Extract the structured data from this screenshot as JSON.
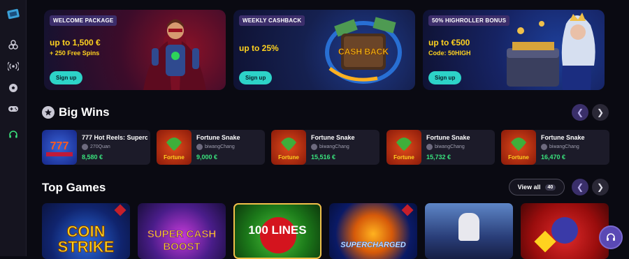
{
  "sidebar": {
    "items": [
      {
        "icon": "logo-icon"
      },
      {
        "icon": "dice-icon"
      },
      {
        "icon": "live-broadcast-icon"
      },
      {
        "icon": "soccer-ball-icon"
      },
      {
        "icon": "gamepad-icon"
      },
      {
        "icon": "headset-icon"
      }
    ]
  },
  "banners": [
    {
      "tag": "WELCOME PACKAGE",
      "line1": "up to 1,500 €",
      "line2": "+ 250 Free Spins",
      "button": "Sign up",
      "art": "superhero-illustration"
    },
    {
      "tag": "WEEKLY CASHBACK",
      "line1": "up to 25%",
      "line2": "",
      "button": "Sign up",
      "art": "cash-back-illustration",
      "art_text": "CASH BACK"
    },
    {
      "tag": "50% HIGHROLLER BONUS",
      "line1": "up to €500",
      "line2": "Code: 50HIGH",
      "button": "Sign up",
      "art": "treasure-queen-illustration"
    }
  ],
  "big_wins": {
    "title": "Big Wins",
    "items": [
      {
        "game": "777 Hot Reels: Superc",
        "user": "270Quan",
        "amount": "8,580 €"
      },
      {
        "game": "Fortune Snake",
        "user": "biwangChang",
        "amount": "9,000 €"
      },
      {
        "game": "Fortune Snake",
        "user": "biwangChang",
        "amount": "15,516 €"
      },
      {
        "game": "Fortune Snake",
        "user": "biwangChang",
        "amount": "15,732 €"
      },
      {
        "game": "Fortune Snake",
        "user": "biwangChang",
        "amount": "16,470 €"
      }
    ]
  },
  "top_games": {
    "title": "Top Games",
    "view_all": "View all",
    "count": "40",
    "tiles": [
      {
        "title": "COIN STRIKE"
      },
      {
        "title": "SUPER CASH BOOST"
      },
      {
        "title": "100 LINES"
      },
      {
        "title": "SUPERCHARGED"
      },
      {
        "title": ""
      },
      {
        "title": ""
      }
    ]
  },
  "colors": {
    "accent": "#2dd3c8",
    "win_green": "#39e37d",
    "offer_yellow": "#ffd21f",
    "tag_purple": "#3c2e6b"
  }
}
